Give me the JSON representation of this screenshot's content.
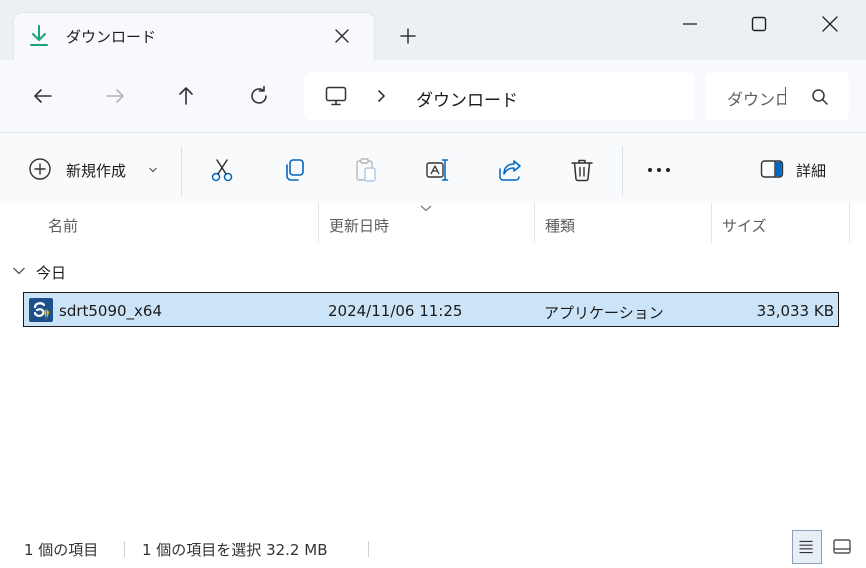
{
  "tab": {
    "title": "ダウンロード"
  },
  "nav": {
    "address": "ダウンロード",
    "search_placeholder": "ダウンロードの検索"
  },
  "toolbar": {
    "new_label": "新規作成",
    "details_label": "詳細",
    "icons": [
      "cut-icon",
      "copy-icon",
      "paste-icon",
      "rename-icon",
      "share-icon",
      "delete-icon",
      "more-icon"
    ]
  },
  "columns": {
    "name": "名前",
    "modified": "更新日時",
    "type": "種類",
    "size": "サイズ"
  },
  "groups": [
    {
      "label": "今日",
      "files": [
        {
          "name": "sdrt5090_x64",
          "modified": "2024/11/06 11:25",
          "type": "アプリケーション",
          "size": "33,033 KB"
        }
      ]
    }
  ],
  "status": {
    "item_count": "1 個の項目",
    "selection": "1 個の項目を選択  32.2 MB"
  },
  "colors": {
    "accent": "#0067c0",
    "selection_bg": "#cce4f7",
    "download_green": "#1aa37a"
  }
}
